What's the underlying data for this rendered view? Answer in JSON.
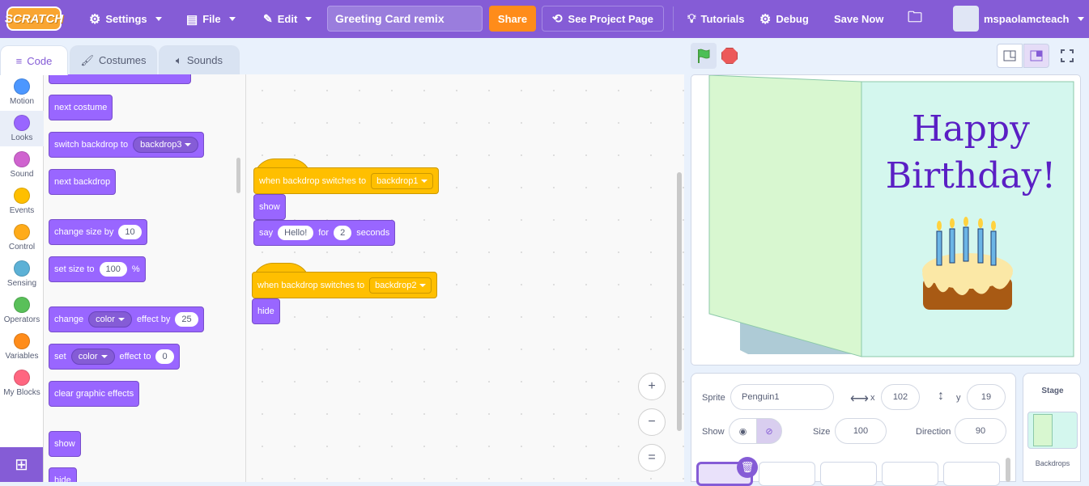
{
  "menu": {
    "logo": "SCRATCH",
    "settings": "Settings",
    "file": "File",
    "edit": "Edit",
    "project_title": "Greeting Card remix",
    "share": "Share",
    "see_project": "See Project Page",
    "tutorials": "Tutorials",
    "debug": "Debug",
    "save_now": "Save Now",
    "username": "mspaolamcteach"
  },
  "tabs": {
    "code": "Code",
    "costumes": "Costumes",
    "sounds": "Sounds"
  },
  "categories": [
    {
      "label": "Motion",
      "color": "#4c97ff"
    },
    {
      "label": "Looks",
      "color": "#9966ff"
    },
    {
      "label": "Sound",
      "color": "#cf63cf"
    },
    {
      "label": "Events",
      "color": "#ffbf00"
    },
    {
      "label": "Control",
      "color": "#ffab19"
    },
    {
      "label": "Sensing",
      "color": "#5cb1d6"
    },
    {
      "label": "Operators",
      "color": "#59c059"
    },
    {
      "label": "Variables",
      "color": "#ff8c1a"
    },
    {
      "label": "My Blocks",
      "color": "#ff6680"
    }
  ],
  "palette": {
    "next_costume": "next costume",
    "switch_backdrop": "switch backdrop to",
    "switch_backdrop_value": "backdrop3",
    "next_backdrop": "next backdrop",
    "change_size": "change size by",
    "change_size_value": "10",
    "set_size": "set size to",
    "set_size_value": "100",
    "set_size_unit": "%",
    "change_effect": "change",
    "change_effect_value": "color",
    "change_effect_by": "effect by",
    "change_effect_amount": "25",
    "set_effect": "set",
    "set_effect_value": "color",
    "set_effect_to": "effect to",
    "set_effect_amount": "0",
    "clear_effects": "clear graphic effects",
    "show": "show",
    "hide": "hide"
  },
  "script1": {
    "hat": "when backdrop switches to",
    "hat_value": "backdrop1",
    "show": "show",
    "say": "say",
    "say_text": "Hello!",
    "for": "for",
    "secs": "2",
    "seconds": "seconds"
  },
  "script2": {
    "hat": "when backdrop switches to",
    "hat_value": "backdrop2",
    "hide": "hide"
  },
  "zoom": {
    "in": "+",
    "out": "−",
    "reset": "="
  },
  "stage": {
    "card_line1": "Happy",
    "card_line2": "Birthday!"
  },
  "sprite": {
    "sprite_label": "Sprite",
    "name": "Penguin1",
    "x_label": "x",
    "x": "102",
    "y_label": "y",
    "y": "19",
    "show_label": "Show",
    "size_label": "Size",
    "size": "100",
    "direction_label": "Direction",
    "direction": "90"
  },
  "stage_panel": {
    "title": "Stage",
    "backdrops": "Backdrops"
  }
}
